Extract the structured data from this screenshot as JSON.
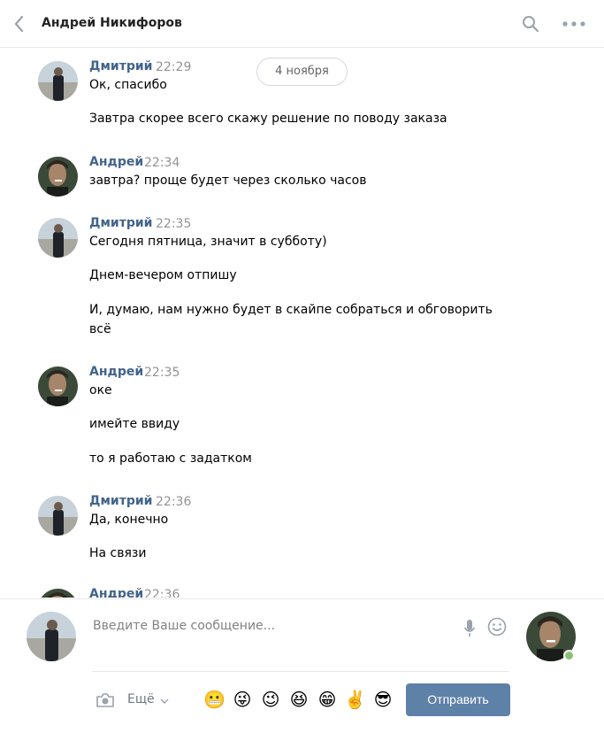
{
  "header": {
    "title": "Андрей Никифоров"
  },
  "date_separator": "4 ноября",
  "messages": [
    {
      "author": "Дмитрий",
      "time": "22:29",
      "who": "dmitry",
      "lines": [
        "Ок, спасибо",
        "Завтра скорее всего скажу решение по поводу заказа"
      ]
    },
    {
      "author": "Андрей",
      "time": "22:34",
      "who": "andrey",
      "lines": [
        "завтра? проще будет через сколько часов"
      ]
    },
    {
      "author": "Дмитрий",
      "time": "22:35",
      "who": "dmitry",
      "lines": [
        "Сегодня пятница, значит в субботу)",
        "Днем-вечером отпишу",
        "И, думаю, нам нужно будет в скайпе собраться и обговорить всё"
      ]
    },
    {
      "author": "Андрей",
      "time": "22:35",
      "who": "andrey",
      "lines": [
        "оке",
        "имейте ввиду",
        "то я работаю с задатком"
      ]
    },
    {
      "author": "Дмитрий",
      "time": "22:36",
      "who": "dmitry",
      "lines": [
        "Да, конечно",
        "На связи"
      ]
    },
    {
      "author": "Андрей",
      "time": "22:36",
      "who": "andrey",
      "lines": []
    }
  ],
  "composer": {
    "placeholder": "Введите Ваше сообщение...",
    "more_label": "Ещё",
    "send_label": "Отправить",
    "emojis": [
      "😬",
      "😜",
      "😉",
      "😆",
      "😁",
      "✌️",
      "😎"
    ]
  },
  "colors": {
    "accent": "#5e81a8",
    "author": "#42648b",
    "online": "#8ac176"
  }
}
